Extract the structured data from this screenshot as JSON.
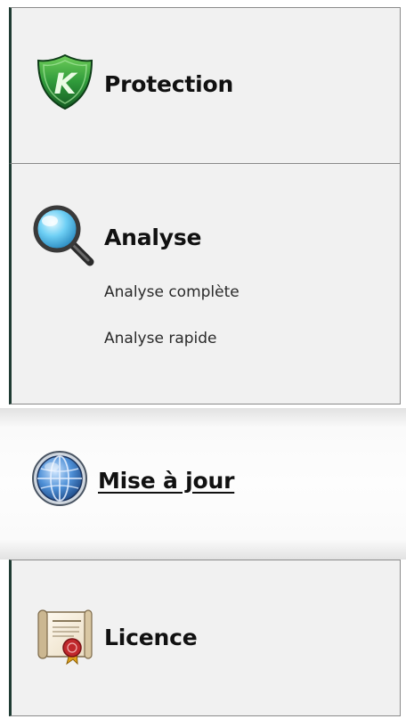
{
  "nav": {
    "protection": {
      "label": "Protection",
      "icon": "shield-icon"
    },
    "analyse": {
      "label": "Analyse",
      "icon": "magnifier-icon",
      "items": [
        {
          "label": "Analyse complète"
        },
        {
          "label": "Analyse rapide"
        }
      ]
    },
    "update": {
      "label": "Mise à jour",
      "icon": "globe-icon",
      "active": true
    },
    "licence": {
      "label": "Licence",
      "icon": "certificate-icon"
    }
  },
  "colors": {
    "panel_bg": "#f1f1f1",
    "border": "#8a8a8a",
    "left_edge": "#1f3b33",
    "shield_green": "#2e8b3a",
    "magnifier_blue": "#39a3d8",
    "globe_blue": "#2f6bb0",
    "seal_red": "#c0282c"
  }
}
